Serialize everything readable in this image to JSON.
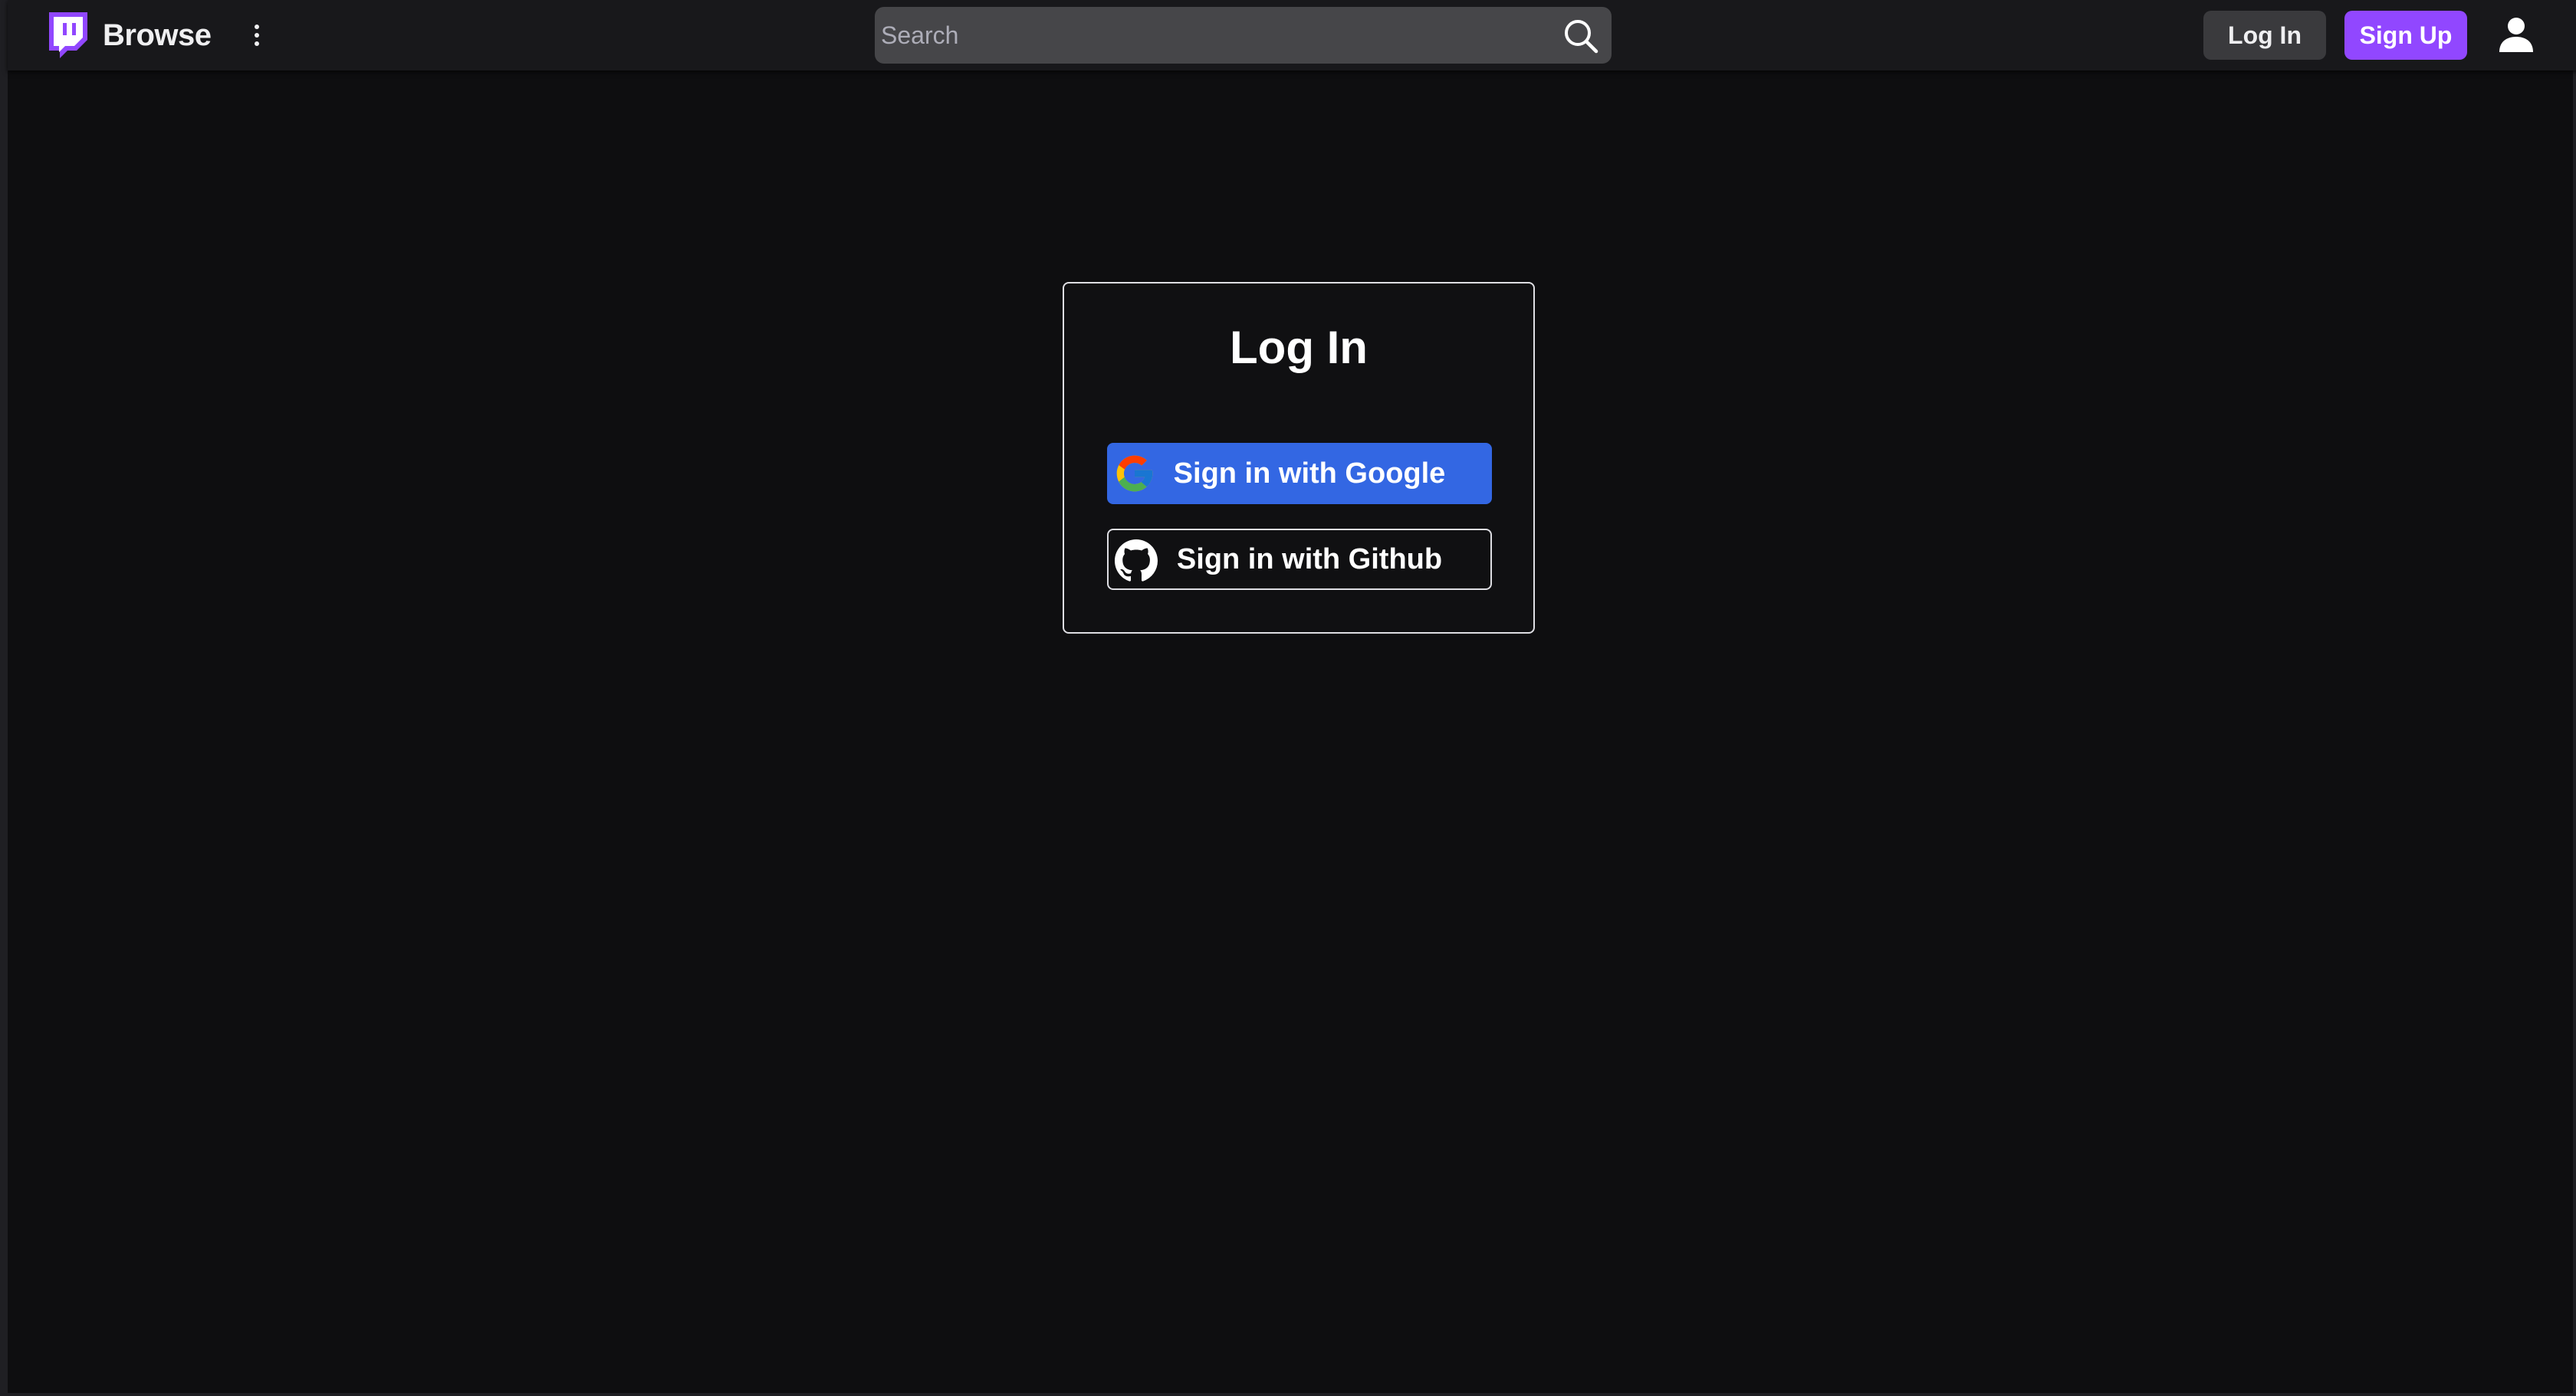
{
  "header": {
    "brand": "Browse",
    "logo_icon": "twitch-logo-icon",
    "menu_icon": "more-vertical-icon",
    "search": {
      "placeholder": "Search",
      "value": "",
      "icon": "search-icon"
    },
    "login_label": "Log In",
    "signup_label": "Sign Up",
    "user_icon": "user-icon"
  },
  "login_card": {
    "title": "Log In",
    "google": {
      "label": "Sign in with Google",
      "icon": "google-icon"
    },
    "github": {
      "label": "Sign in with Github",
      "icon": "github-icon"
    }
  },
  "colors": {
    "background": "#0e0e10",
    "nav_background": "#18181b",
    "search_background": "#464649",
    "login_button": "#3a3a3d",
    "signup_button": "#9147ff",
    "google_button": "#3367e3",
    "card_border": "#dedee3"
  }
}
